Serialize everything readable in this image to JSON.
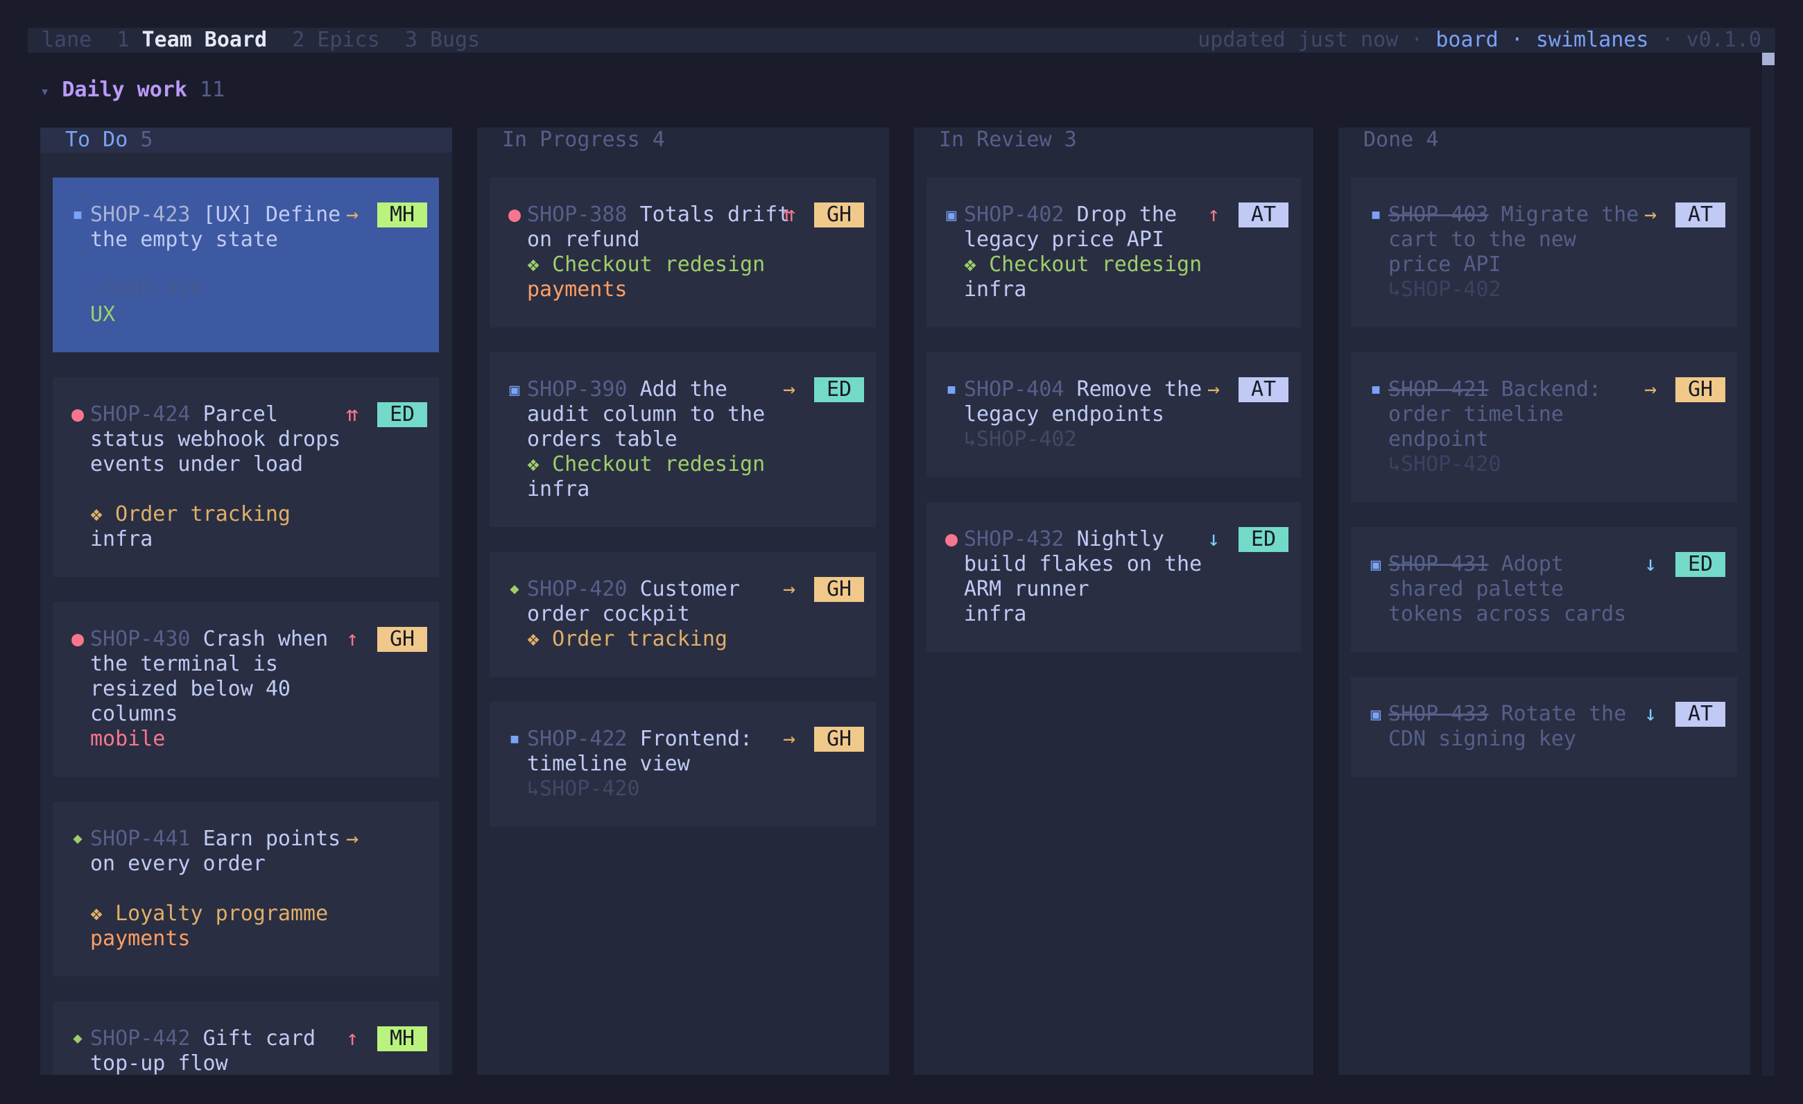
{
  "colors": {
    "background": "#1a1c2b",
    "panel": "#24283b",
    "card": "#292e42",
    "card_selected": "#3d59a1",
    "accent": "#7aa2f7",
    "lane": "#bb9af7",
    "prio_red": "#f7768e",
    "prio_orange": "#e0af68",
    "prio_blue": "#7dcfff"
  },
  "topbar": {
    "prefix": "lane",
    "tabs": [
      {
        "num": "1",
        "label": "Team Board"
      },
      {
        "num": "2",
        "label": "Epics"
      },
      {
        "num": "3",
        "label": "Bugs"
      }
    ],
    "status": "updated just now",
    "sep": "·",
    "view_board": "board",
    "view_swimlanes": "swimlanes",
    "version": "v0.1.0"
  },
  "lane": {
    "triangle": "▾",
    "name": "Daily work",
    "count": "11"
  },
  "columns": [
    {
      "title": "To Do",
      "count": "5",
      "cards": [
        {
          "type_glyph": "■",
          "key": "SHOP-423",
          "lines": [
            "[UX] Define",
            "the empty state"
          ],
          "prio": "→",
          "assignee": "MH",
          "parent": "↳SHOP-420",
          "label": "UX"
        },
        {
          "type_glyph": "●",
          "key": "SHOP-424",
          "lines": [
            "Parcel",
            "status webhook drops",
            "events under load"
          ],
          "prio": "⇈",
          "assignee": "ED",
          "epic": "❖ Order tracking",
          "label": "infra"
        },
        {
          "type_glyph": "●",
          "key": "SHOP-430",
          "lines": [
            "Crash when",
            "the terminal is",
            "resized below 40",
            "columns"
          ],
          "prio": "↑",
          "assignee": "GH",
          "label": "mobile"
        },
        {
          "type_glyph": "◆",
          "key": "SHOP-441",
          "lines": [
            "Earn points",
            "on every order"
          ],
          "prio": "→",
          "epic": "❖ Loyalty programme",
          "label": "payments"
        },
        {
          "type_glyph": "◆",
          "key": "SHOP-442",
          "lines": [
            "Gift card",
            "top-up flow"
          ],
          "prio": "↑",
          "assignee": "MH"
        }
      ]
    },
    {
      "title": "In Progress",
      "count": "4",
      "cards": [
        {
          "type_glyph": "●",
          "key": "SHOP-388",
          "lines": [
            "Totals drift",
            "on refund"
          ],
          "prio": "⇈",
          "assignee": "GH",
          "epic": "❖ Checkout redesign",
          "label": "payments"
        },
        {
          "type_glyph": "▣",
          "key": "SHOP-390",
          "lines": [
            "Add the",
            "audit column to the",
            "orders table"
          ],
          "prio": "→",
          "assignee": "ED",
          "epic": "❖ Checkout redesign",
          "label": "infra"
        },
        {
          "type_glyph": "◆",
          "key": "SHOP-420",
          "lines": [
            "Customer",
            "order cockpit"
          ],
          "prio": "→",
          "assignee": "GH",
          "epic": "❖ Order tracking"
        },
        {
          "type_glyph": "■",
          "key": "SHOP-422",
          "lines": [
            "Frontend:",
            "timeline view"
          ],
          "prio": "→",
          "assignee": "GH",
          "parent": "↳SHOP-420"
        }
      ]
    },
    {
      "title": "In Review",
      "count": "3",
      "cards": [
        {
          "type_glyph": "▣",
          "key": "SHOP-402",
          "lines": [
            "Drop the",
            "legacy price API"
          ],
          "prio": "↑",
          "assignee": "AT",
          "epic": "❖ Checkout redesign",
          "label": "infra"
        },
        {
          "type_glyph": "■",
          "key": "SHOP-404",
          "lines": [
            "Remove the",
            "legacy endpoints"
          ],
          "prio": "→",
          "assignee": "AT",
          "parent": "↳SHOP-402"
        },
        {
          "type_glyph": "●",
          "key": "SHOP-432",
          "lines": [
            "Nightly",
            "build flakes on the",
            "ARM runner"
          ],
          "prio": "↓",
          "assignee": "ED",
          "label": "infra"
        }
      ]
    },
    {
      "title": "Done",
      "count": "4",
      "cards": [
        {
          "type_glyph": "■",
          "key": "SHOP-403",
          "lines": [
            "Migrate the",
            "cart to the new",
            "price API"
          ],
          "prio": "→",
          "assignee": "AT",
          "parent": "↳SHOP-402"
        },
        {
          "type_glyph": "■",
          "key": "SHOP-421",
          "lines": [
            "Backend:",
            "order timeline",
            "endpoint"
          ],
          "prio": "→",
          "assignee": "GH",
          "parent": "↳SHOP-420"
        },
        {
          "type_glyph": "▣",
          "key": "SHOP-431",
          "lines": [
            "Adopt",
            "shared palette",
            "tokens across cards"
          ],
          "prio": "↓",
          "assignee": "ED"
        },
        {
          "type_glyph": "▣",
          "key": "SHOP-433",
          "lines": [
            "Rotate the",
            "CDN signing key"
          ],
          "prio": "↓",
          "assignee": "AT"
        }
      ]
    }
  ]
}
